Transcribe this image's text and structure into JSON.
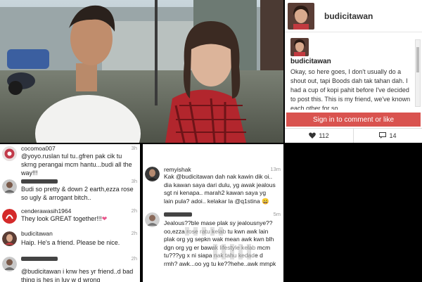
{
  "post": {
    "username": "budicitawan",
    "caption": "Okay, so here goes, I don't usually do a shout out, tapi Boods dah tak tahan dah. I had a cup of kopi pahit before I've decided to post this. This is my friend, we've known each other for so",
    "signin_label": "Sign in to comment or like",
    "likes": "112",
    "comments_count": "14"
  },
  "comments_left": [
    {
      "user": "cocomoa007",
      "time": "3h",
      "text": "@yoyo.ruslan tul tu..gfren pak cik tu skrng perangai mcm hantu...budi all the way!!!"
    },
    {
      "user": "",
      "time": "3h",
      "text": "Budi so pretty & down 2 earth,ezza rose so ugly & arrogant bitch.."
    },
    {
      "user": "cenderawasih1964",
      "time": "2h",
      "text": "They look GREAT together!!!"
    },
    {
      "user": "budicitawan",
      "time": "2h",
      "text": "Haip. He's a friend. Please be nice."
    },
    {
      "user": "",
      "time": "2h",
      "text": "@budicitawan i knw hes yr friend..d bad thing is hes in luv w d wrong person..ezza rose isnt a kind girl.shes"
    }
  ],
  "comments_mid": [
    {
      "user": "remyishak",
      "time": "13m",
      "text": "Kak @budicitawan dah nak kawin dik oi.. dia kawan saya dari dulu, yg awak jealous sgt ni kenapa.. marah2 kawan saya yg lain pula? adoi.. kelakar la @q1stina 😄"
    },
    {
      "user": "",
      "time": "5m",
      "text": "Jealous??ble mase plak sy jealousnye??oo,ezza rose ratu kelab tu kwn awk lain plak org yg sepkn wak mean awk kwn blh dgn org yg er bawak lifestyle kelab mcm tu???yg x ni siapa nak tahu kedade d rmh? awk...oo yg tu ke??hehe..awk mmpk"
    }
  ]
}
